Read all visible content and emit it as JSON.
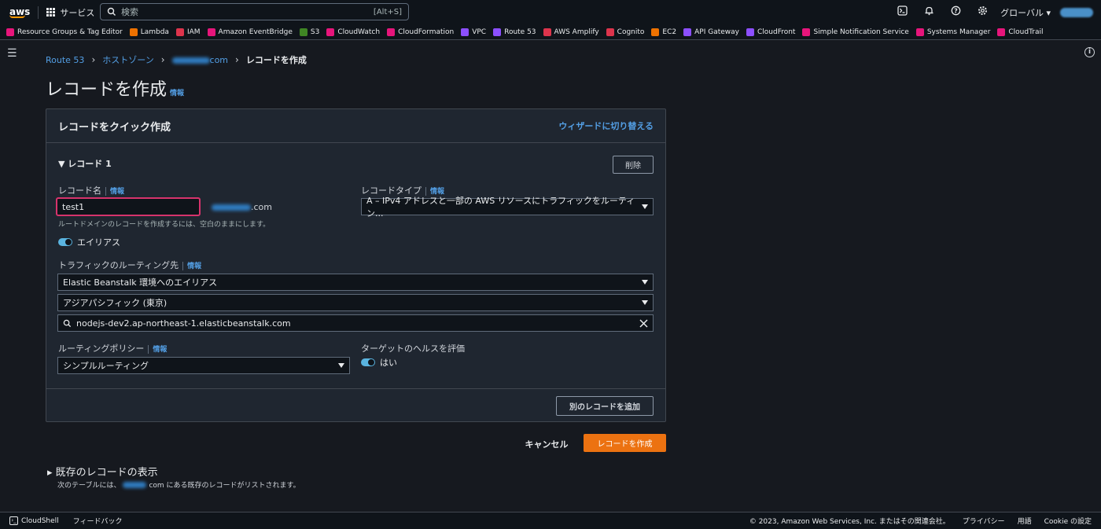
{
  "topnav": {
    "logo_text": "aws",
    "services_label": "サービス",
    "search_placeholder": "検索",
    "search_shortcut": "[Alt+S]",
    "region_label": "グローバル ▾"
  },
  "favorites": [
    {
      "label": "Resource Groups & Tag Editor",
      "color": "#e7157b"
    },
    {
      "label": "Lambda",
      "color": "#ed7100"
    },
    {
      "label": "IAM",
      "color": "#dd344c"
    },
    {
      "label": "Amazon EventBridge",
      "color": "#e7157b"
    },
    {
      "label": "S3",
      "color": "#3f8624"
    },
    {
      "label": "CloudWatch",
      "color": "#e7157b"
    },
    {
      "label": "CloudFormation",
      "color": "#e7157b"
    },
    {
      "label": "VPC",
      "color": "#8c4fff"
    },
    {
      "label": "Route 53",
      "color": "#8c4fff"
    },
    {
      "label": "AWS Amplify",
      "color": "#dd344c"
    },
    {
      "label": "Cognito",
      "color": "#dd344c"
    },
    {
      "label": "EC2",
      "color": "#ed7100"
    },
    {
      "label": "API Gateway",
      "color": "#8c4fff"
    },
    {
      "label": "CloudFront",
      "color": "#8c4fff"
    },
    {
      "label": "Simple Notification Service",
      "color": "#e7157b"
    },
    {
      "label": "Systems Manager",
      "color": "#e7157b"
    },
    {
      "label": "CloudTrail",
      "color": "#e7157b"
    }
  ],
  "breadcrumb": {
    "route53": "Route 53",
    "hosted_zones": "ホストゾーン",
    "domain_suffix": "com",
    "current": "レコードを作成"
  },
  "page": {
    "title": "レコードを作成",
    "info": "情報"
  },
  "panel": {
    "title": "レコードをクイック作成",
    "wizard_link": "ウィザードに切り替える",
    "record_title": "▼ レコード 1",
    "delete_button": "削除",
    "record_name_label": "レコード名",
    "info": "情報",
    "record_name_value": "test1",
    "record_name_suffix": ".com",
    "record_name_hint": "ルートドメインのレコードを作成するには、空白のままにします。",
    "record_type_label": "レコードタイプ",
    "record_type_value": "A – IPv4 アドレスと一部の AWS リソースにトラフィックをルーティン...",
    "alias_label": "エイリアス",
    "routing_target_label": "トラフィックのルーティング先",
    "routing_target_value": "Elastic Beanstalk 環境へのエイリアス",
    "region_value": "アジアパシフィック (東京)",
    "endpoint_value": "nodejs-dev2.ap-northeast-1.elasticbeanstalk.com",
    "routing_policy_label": "ルーティングポリシー",
    "routing_policy_value": "シンプルルーティング",
    "health_label": "ターゲットのヘルスを評価",
    "health_value": "はい",
    "add_record_button": "別のレコードを追加"
  },
  "actions": {
    "cancel": "キャンセル",
    "create": "レコードを作成"
  },
  "existing": {
    "title": "▸ 既存のレコードの表示",
    "sub_prefix": "次のテーブルには、",
    "sub_suffix": "com にある既存のレコードがリストされます。"
  },
  "footer": {
    "cloudshell": "CloudShell",
    "feedback": "フィードバック",
    "copyright": "© 2023, Amazon Web Services, Inc. またはその関連会社。",
    "privacy": "プライバシー",
    "terms": "用語",
    "cookie": "Cookie の設定"
  }
}
